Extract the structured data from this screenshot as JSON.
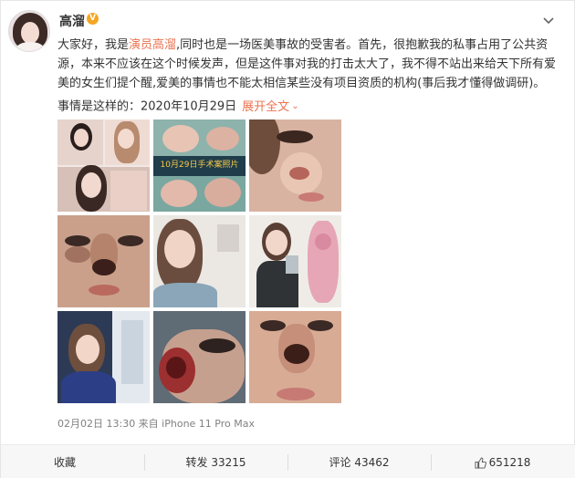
{
  "post": {
    "author": "高溜",
    "verified_badge": "V",
    "text_part1": "大家好，我是",
    "mention": "演员高溜",
    "text_part2": ",同时也是一场医美事故的受害者。首先，很抱歉我的私事占用了公共资源，本来不应该在这个时候发声，但是这件事对我的打击太大了，我不得不站出来给天下所有爱美的女生们提个醒,爱美的事情也不能太相信某些没有项目资质的机构(事后我才懂得做调研)。",
    "date_line": "事情是这样的：2020年10月29日",
    "expand_label": "展开全文",
    "meta": "02月02日 13:30 来自 iPhone 11 Pro Max"
  },
  "photos": [
    {
      "label": "collage-selfies"
    },
    {
      "label": "10月29日手术案照片"
    },
    {
      "label": "nose-closeup-1"
    },
    {
      "label": "bruised-face-1"
    },
    {
      "label": "hospital-selfie"
    },
    {
      "label": "mirror-selfie"
    },
    {
      "label": "mall-selfie"
    },
    {
      "label": "surgery-wound"
    },
    {
      "label": "nose-closeup-2"
    }
  ],
  "collage_caption": "10月29日手术案照片",
  "actions": {
    "favorite": "收藏",
    "repost": "转发 33215",
    "comment": "评论 43462",
    "like": "651218"
  },
  "colors": {
    "accent": "#eb7350",
    "badge": "#f5a623",
    "meta_gray": "#808080"
  },
  "icons": [
    "chevron-down-icon",
    "thumb-up-icon",
    "verified-icon"
  ]
}
